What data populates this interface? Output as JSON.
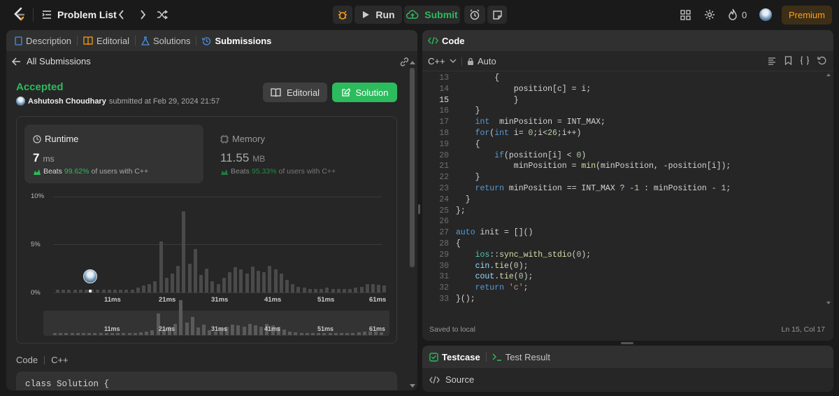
{
  "topbar": {
    "problem_list": "Problem List",
    "run": "Run",
    "submit": "Submit",
    "streak": "0",
    "premium": "Premium"
  },
  "left": {
    "tabs": [
      "Description",
      "Editorial",
      "Solutions",
      "Submissions"
    ],
    "all_submissions": "All Submissions",
    "status": "Accepted",
    "user": "Ashutosh Choudhary",
    "submitted": "submitted at Feb 29, 2024 21:57",
    "editorial_btn": "Editorial",
    "solution_btn": "Solution",
    "runtime": {
      "label": "Runtime",
      "value": "7",
      "unit": "ms",
      "beats": "Beats",
      "pct": "99.62%",
      "rest": "of users with C++"
    },
    "memory": {
      "label": "Memory",
      "value": "11.55",
      "unit": "MB",
      "beats": "Beats",
      "pct": "95.33%",
      "rest": "of users with C++"
    },
    "code_label": "Code",
    "lang": "C++",
    "code_preview": "class Solution {"
  },
  "chart_data": {
    "type": "bar",
    "yticks": [
      "10%",
      "5%",
      "0%"
    ],
    "xticks": [
      "11ms",
      "21ms",
      "31ms",
      "41ms",
      "51ms",
      "61ms"
    ],
    "ylim": [
      0,
      10
    ],
    "values": [
      0.3,
      0.3,
      0.3,
      0.3,
      0.3,
      0.3,
      0.3,
      0.3,
      0.3,
      0.3,
      0.3,
      0.3,
      0.3,
      0.3,
      0.5,
      0.7,
      0.9,
      1.2,
      5.3,
      1.5,
      2.0,
      2.8,
      8.5,
      3.0,
      4.5,
      1.8,
      2.5,
      1.2,
      0.9,
      1.5,
      2.1,
      2.6,
      2.4,
      2.0,
      2.7,
      2.3,
      2.1,
      2.8,
      2.4,
      2.0,
      1.3,
      0.9,
      0.6,
      0.5,
      0.4,
      0.4,
      0.4,
      0.5,
      0.4,
      0.4,
      0.4,
      0.4,
      0.5,
      0.6,
      0.9,
      0.9,
      0.8,
      0.7
    ],
    "highlight_index": 6
  },
  "right": {
    "code_tab": "Code",
    "lang": "C++",
    "mode": "Auto",
    "saved": "Saved to local",
    "cursor": "Ln 15, Col 17",
    "testcase": "Testcase",
    "test_result": "Test Result",
    "source": "Source",
    "start_line": 13,
    "lines": [
      [
        [
          8,
          "{"
        ]
      ],
      [
        [
          12,
          "position[c] = i;"
        ]
      ],
      [
        [
          12,
          "}"
        ]
      ],
      [
        [
          4,
          "}"
        ]
      ],
      [
        [
          4,
          "int",
          "kw"
        ],
        [
          8,
          " minPosition = INT_MAX;"
        ]
      ],
      [
        [
          4,
          "for",
          "kw"
        ],
        [
          7,
          "("
        ],
        [
          8,
          "int",
          "kw"
        ],
        [
          11,
          " i="
        ],
        [
          15,
          "0",
          "nm"
        ],
        [
          16,
          ";i<"
        ],
        [
          19,
          "26",
          "nm"
        ],
        [
          21,
          ";i++)"
        ]
      ],
      [
        [
          4,
          "{"
        ]
      ],
      [
        [
          8,
          "if",
          "kw"
        ],
        [
          10,
          "(position[i] < "
        ],
        [
          25,
          "0",
          "nm"
        ],
        [
          26,
          ")"
        ]
      ],
      [
        [
          12,
          "minPosition = "
        ],
        [
          26,
          "min",
          "fn"
        ],
        [
          29,
          "(minPosition, -position[i]);"
        ]
      ],
      [
        [
          4,
          "}"
        ]
      ],
      [
        [
          4,
          "return",
          "kw"
        ],
        [
          10,
          " minPosition == INT_MAX ? -"
        ],
        [
          37,
          "1",
          "nm"
        ],
        [
          38,
          " : minPosition - "
        ],
        [
          55,
          "1",
          "nm"
        ],
        [
          56,
          ";"
        ]
      ],
      [
        [
          2,
          "}"
        ]
      ],
      [
        [
          0,
          "};"
        ]
      ],
      [],
      [
        [
          0,
          "auto",
          "kw"
        ],
        [
          4,
          " init = []()"
        ]
      ],
      [
        [
          0,
          "{"
        ]
      ],
      [
        [
          4,
          "ios",
          "ty"
        ],
        [
          7,
          "::"
        ],
        [
          9,
          "sync_with_stdio",
          "fn"
        ],
        [
          24,
          "("
        ],
        [
          25,
          "0",
          "nm"
        ],
        [
          26,
          ");"
        ]
      ],
      [
        [
          4,
          "cin",
          "vr"
        ],
        [
          7,
          "."
        ],
        [
          8,
          "tie",
          "fn"
        ],
        [
          11,
          "("
        ],
        [
          12,
          "0",
          "nm"
        ],
        [
          13,
          ");"
        ]
      ],
      [
        [
          4,
          "cout",
          "vr"
        ],
        [
          8,
          "."
        ],
        [
          9,
          "tie",
          "fn"
        ],
        [
          12,
          "("
        ],
        [
          13,
          "0",
          "nm"
        ],
        [
          14,
          ");"
        ]
      ],
      [
        [
          4,
          "return",
          "kw"
        ],
        [
          10,
          " "
        ],
        [
          11,
          "'c'",
          "st"
        ],
        [
          14,
          ";"
        ]
      ],
      [
        [
          0,
          "}();"
        ]
      ]
    ]
  },
  "colors": {
    "accent": "#2cbb5d",
    "orange": "#ffa116",
    "premium": "#ffa116"
  }
}
